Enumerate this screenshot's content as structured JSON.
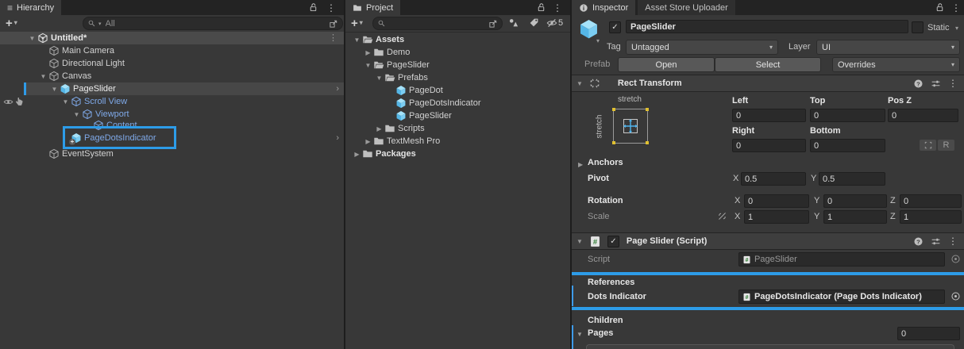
{
  "colors": {
    "annotation_blue": "#2D9CE8",
    "prefab_text_blue": "#7FA9E8",
    "prefab_icon_blue": "#6EC8F0",
    "override_bar_blue": "#3E9BE9"
  },
  "hierarchy": {
    "tab_label": "Hierarchy",
    "add_label": "+",
    "search_placeholder": "All",
    "scene_label": "Untitled*",
    "items": {
      "main_camera": "Main Camera",
      "directional_light": "Directional Light",
      "canvas": "Canvas",
      "page_slider": "PageSlider",
      "scroll_view": "Scroll View",
      "viewport": "Viewport",
      "content": "Content",
      "page_dots_indicator": "PageDotsIndicator",
      "event_system": "EventSystem"
    }
  },
  "project": {
    "tab_label": "Project",
    "add_label": "+",
    "search_placeholder": "",
    "hidden_count": "5",
    "items": {
      "assets": "Assets",
      "demo": "Demo",
      "page_slider_folder": "PageSlider",
      "prefabs": "Prefabs",
      "page_dot": "PageDot",
      "page_dots_indicator": "PageDotsIndicator",
      "page_slider_prefab": "PageSlider",
      "scripts": "Scripts",
      "textmesh_pro": "TextMesh Pro",
      "packages": "Packages"
    }
  },
  "inspector": {
    "tab_label": "Inspector",
    "tab2_label": "Asset Store Uploader",
    "header": {
      "name": "PageSlider",
      "static_label": "Static",
      "tag_label": "Tag",
      "tag_value": "Untagged",
      "layer_label": "Layer",
      "layer_value": "UI",
      "prefab_label": "Prefab",
      "open_label": "Open",
      "select_label": "Select",
      "overrides_label": "Overrides"
    },
    "rect_transform": {
      "title": "Rect Transform",
      "stretch_h": "stretch",
      "stretch_v": "stretch",
      "left_label": "Left",
      "left": "0",
      "top_label": "Top",
      "top": "0",
      "posz_label": "Pos Z",
      "posz": "0",
      "right_label": "Right",
      "right": "0",
      "bottom_label": "Bottom",
      "bottom": "0",
      "r_button": "R",
      "anchors_label": "Anchors",
      "pivot_label": "Pivot",
      "pivot_x": "0.5",
      "pivot_y": "0.5",
      "rotation_label": "Rotation",
      "rot_x": "0",
      "rot_y": "0",
      "rot_z": "0",
      "scale_label": "Scale",
      "scale_x": "1",
      "scale_y": "1",
      "scale_z": "1",
      "axis_x": "X",
      "axis_y": "Y",
      "axis_z": "Z"
    },
    "page_slider": {
      "title": "Page Slider (Script)",
      "script_label": "Script",
      "script_value": "PageSlider",
      "references_label": "References",
      "dots_label": "Dots Indicator",
      "dots_value": "PageDotsIndicator (Page Dots Indicator)",
      "children_label": "Children",
      "pages_label": "Pages",
      "pages_value": "0"
    }
  }
}
